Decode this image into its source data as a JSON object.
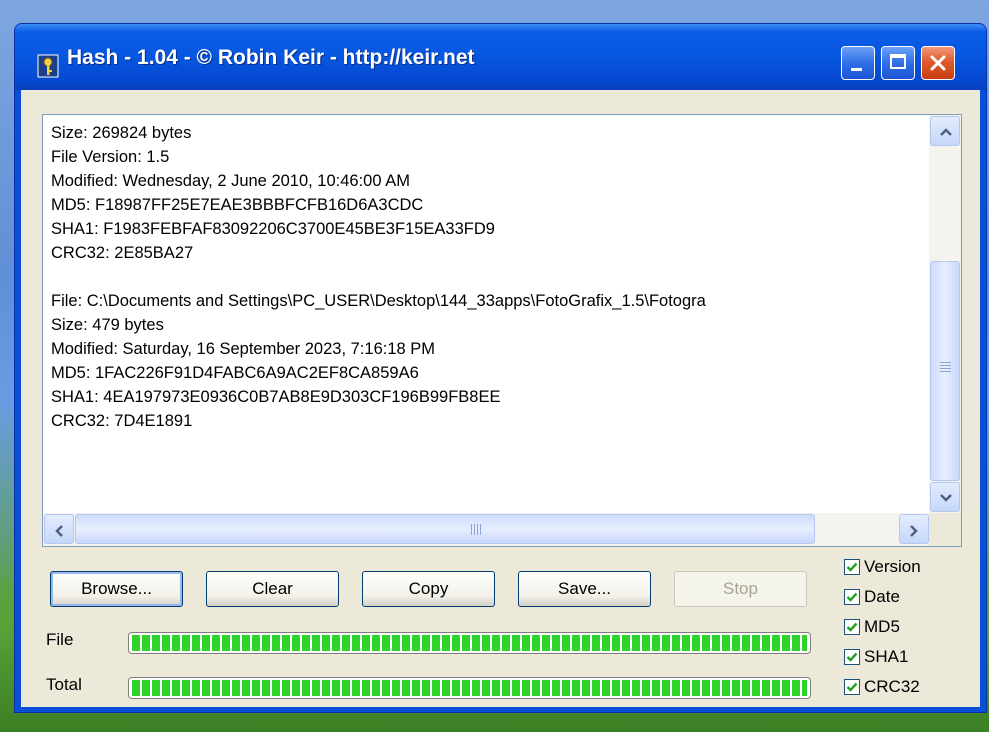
{
  "window": {
    "title": "Hash - 1.04 - © Robin Keir - http://keir.net"
  },
  "output": {
    "text": "Size: 269824 bytes\nFile Version: 1.5\nModified: Wednesday, 2 June 2010, 10:46:00 AM\nMD5: F18987FF25E7EAE3BBBFCFB16D6A3CDC\nSHA1: F1983FEBFAF83092206C3700E45BE3F15EA33FD9\nCRC32: 2E85BA27\n\nFile: C:\\Documents and Settings\\PC_USER\\Desktop\\144_33apps\\FotoGrafix_1.5\\Fotogra\nSize: 479 bytes\nModified: Saturday, 16 September 2023, 7:16:18 PM\nMD5: 1FAC226F91D4FABC6A9AC2EF8CA859A6\nSHA1: 4EA197973E0936C0B7AB8E9D303CF196B99FB8EE\nCRC32: 7D4E1891"
  },
  "buttons": {
    "browse": "Browse...",
    "clear": "Clear",
    "copy": "Copy",
    "save": "Save...",
    "stop": "Stop"
  },
  "progress": {
    "file_label": "File",
    "total_label": "Total",
    "file_fraction": 1.0,
    "total_fraction": 1.0
  },
  "options": [
    {
      "label": "Version",
      "checked": true
    },
    {
      "label": "Date",
      "checked": true
    },
    {
      "label": "MD5",
      "checked": true
    },
    {
      "label": "SHA1",
      "checked": true
    },
    {
      "label": "CRC32",
      "checked": true
    }
  ],
  "colors": {
    "titlebar": "#0656e0",
    "progress_fill": "#2ed42a",
    "close_button": "#e05a2c"
  }
}
